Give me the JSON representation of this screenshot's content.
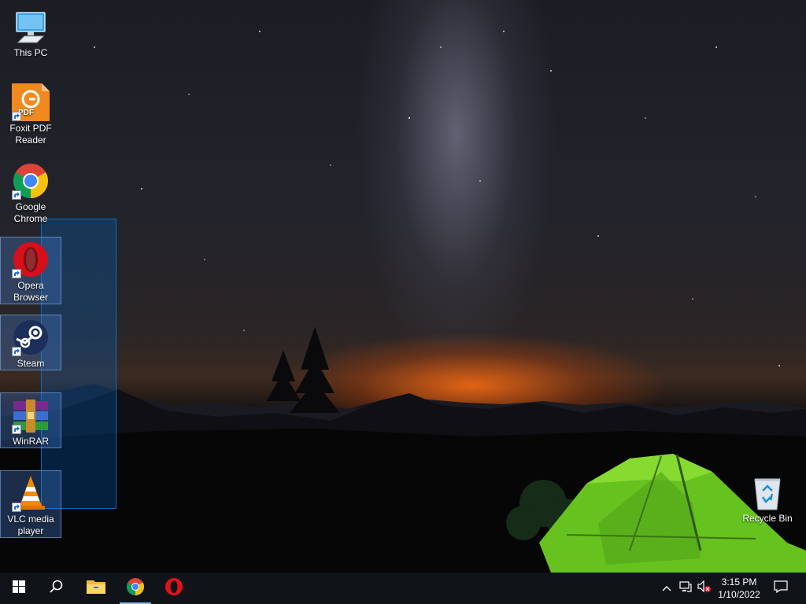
{
  "desktop": {
    "icons": [
      {
        "label": "This PC",
        "icon": "this-pc-icon"
      },
      {
        "label": "Foxit PDF Reader",
        "icon": "foxit-pdf-icon",
        "badge": "PDF"
      },
      {
        "label": "Google Chrome",
        "icon": "chrome-icon"
      },
      {
        "label": "Opera Browser",
        "icon": "opera-icon"
      },
      {
        "label": "Steam",
        "icon": "steam-icon"
      },
      {
        "label": "WinRAR",
        "icon": "winrar-icon"
      },
      {
        "label": "VLC media player",
        "icon": "vlc-icon"
      }
    ],
    "selected_icons": [
      "Opera Browser",
      "Steam",
      "WinRAR",
      "VLC media player"
    ],
    "recycle_bin": {
      "label": "Recycle Bin",
      "icon": "recycle-bin-icon"
    }
  },
  "taskbar": {
    "start": "windows-start-icon",
    "search": "search-icon",
    "pinned": [
      {
        "name": "File Explorer",
        "icon": "file-explorer-icon",
        "active": false
      },
      {
        "name": "Google Chrome",
        "icon": "chrome-icon",
        "active": true
      },
      {
        "name": "Opera",
        "icon": "opera-icon",
        "active": false
      }
    ],
    "tray_icons": [
      "chevron-up-icon",
      "network-icon",
      "volume-muted-icon"
    ],
    "clock": {
      "time": "3:15 PM",
      "date": "1/10/2022"
    },
    "notifications": "action-center-icon"
  },
  "colors": {
    "taskbar_bg": "#101418",
    "selection": "#0078d7",
    "active_indicator": "#76b9ed"
  }
}
